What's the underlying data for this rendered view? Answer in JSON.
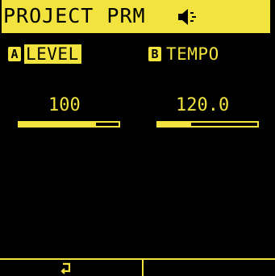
{
  "header": {
    "title": "PROJECT PRM",
    "icon": "speaker-icon"
  },
  "params": [
    {
      "key": "A",
      "label": "LEVEL",
      "selected": true,
      "value": "100",
      "level": 0.77
    },
    {
      "key": "B",
      "label": "TEMPO",
      "selected": false,
      "value": "120.0",
      "level": 0.33
    }
  ],
  "footer": {
    "left_icon": "return-icon",
    "right_label": ""
  },
  "colors": {
    "accent": "#f2e33f",
    "background": "#000000"
  }
}
